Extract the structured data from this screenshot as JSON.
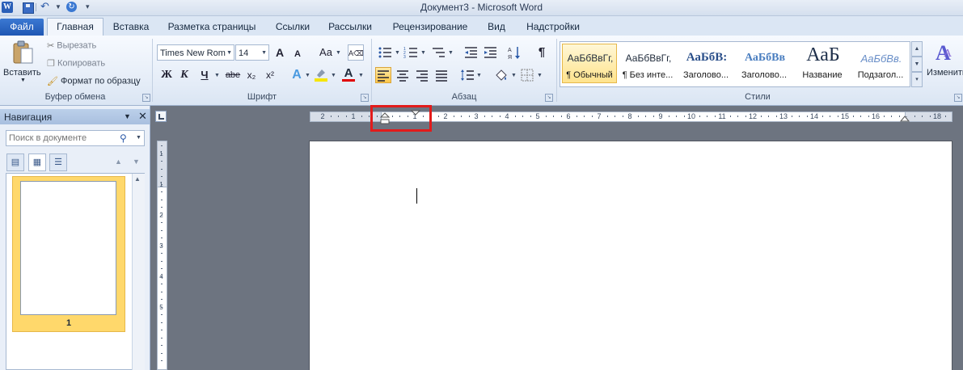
{
  "window": {
    "title": "Документ3  -  Microsoft Word"
  },
  "quick_access": {
    "app_icon": "W"
  },
  "tabs": [
    {
      "label": "Файл"
    },
    {
      "label": "Главная"
    },
    {
      "label": "Вставка"
    },
    {
      "label": "Разметка страницы"
    },
    {
      "label": "Ссылки"
    },
    {
      "label": "Рассылки"
    },
    {
      "label": "Рецензирование"
    },
    {
      "label": "Вид"
    },
    {
      "label": "Надстройки"
    }
  ],
  "clipboard": {
    "group": "Буфер обмена",
    "paste": "Вставить",
    "cut": "Вырезать",
    "copy": "Копировать",
    "format_painter": "Формат по образцу"
  },
  "font": {
    "group": "Шрифт",
    "name": "Times New Rom",
    "size": "14",
    "bold": "Ж",
    "italic": "К",
    "underline": "Ч",
    "strike": "abe",
    "sub": "x₂",
    "sup": "x²",
    "grow": "A",
    "shrink": "A",
    "case": "Aa",
    "highlight_color": "#f5e500",
    "font_color": "#e00000"
  },
  "paragraph": {
    "group": "Абзац",
    "pilcrow": "¶"
  },
  "styles": {
    "group": "Стили",
    "items": [
      {
        "preview": "АаБбВвГг,",
        "name": "¶ Обычный",
        "selected": true
      },
      {
        "preview": "АаБбВвГг,",
        "name": "¶ Без инте..."
      },
      {
        "preview": "АаБбВ:",
        "name": "Заголово..."
      },
      {
        "preview": "АаБбВв",
        "name": "Заголово..."
      },
      {
        "preview": "АаБ",
        "name": "Название"
      },
      {
        "preview": "АаБбВв.",
        "name": "Подзагол..."
      }
    ],
    "change": "Изменить стили"
  },
  "navigation": {
    "title": "Навигация",
    "search_placeholder": "Поиск в документе",
    "page_number": "1"
  },
  "ruler": {
    "h_left": [
      "2",
      "1"
    ],
    "h_marks": [
      "1",
      "2",
      "3",
      "4",
      "5",
      "6",
      "7",
      "8",
      "9",
      "10",
      "11",
      "12",
      "13",
      "14",
      "15",
      "16",
      "·",
      "18"
    ],
    "v_marks": [
      "1",
      "1",
      "2",
      "3",
      "4",
      "5"
    ]
  }
}
